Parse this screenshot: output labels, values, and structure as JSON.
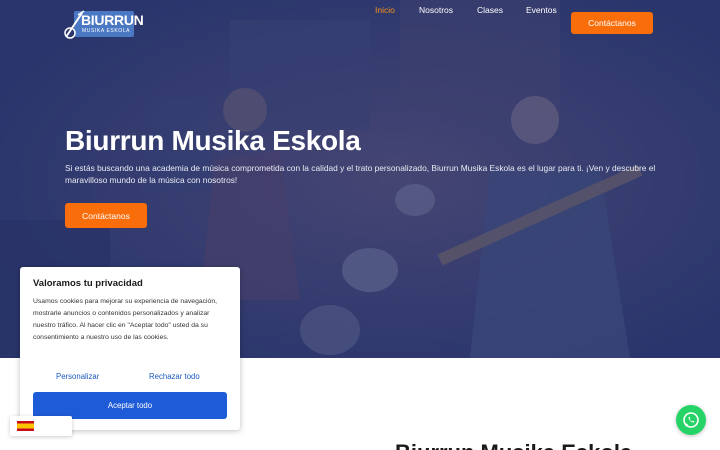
{
  "brand": {
    "logo_title": "BIURRUN",
    "logo_subtitle": "MUSIKA ESKOLA"
  },
  "nav": {
    "items": [
      {
        "label": "Inicio",
        "active": true
      },
      {
        "label": "Nosotros",
        "active": false
      },
      {
        "label": "Clases",
        "active": false
      },
      {
        "label": "Eventos",
        "active": false
      }
    ],
    "cta_label": "Contáctanos"
  },
  "hero": {
    "title": "Biurrun Musika Eskola",
    "text": "Si estás buscando una academia de música comprometida con la calidad y el trato personalizado, Biurrun Musika Eskola es el lugar para ti. ¡Ven y descubre el maravilloso mundo de la música con nosotros!",
    "cta_label": "Contáctanos"
  },
  "cookie": {
    "title": "Valoramos tu privacidad",
    "text": "Usamos cookies para mejorar su experiencia de navegación, mostrarle anuncios o contenidos personalizados y analizar nuestro tráfico. Al hacer clic en \"Aceptar todo\" usted da su consentimiento a nuestro uso de las cookies.",
    "customize_label": "Personalizar",
    "reject_label": "Rechazar todo",
    "accept_label": "Aceptar todo"
  },
  "section": {
    "heading": "Biurrun Musika Eskola"
  },
  "icons": {
    "language_flag": "spain-flag-icon",
    "chat": "whatsapp-icon"
  },
  "colors": {
    "accent_orange": "#f96d0b",
    "nav_active": "#f7931e",
    "accept_blue": "#1e5bd6",
    "link_blue": "#1e5bbf",
    "whatsapp_green": "#25d366"
  }
}
